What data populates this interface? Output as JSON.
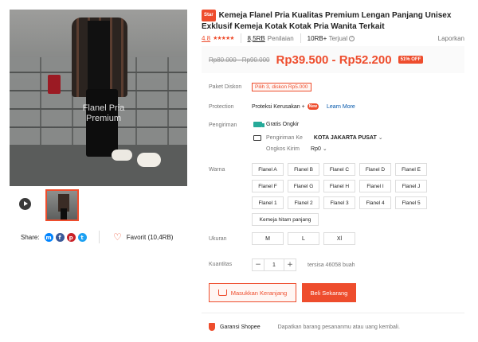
{
  "gallery": {
    "watermark_line1": "Flanel Pria",
    "watermark_line2": "Premium"
  },
  "share": {
    "label": "Share:",
    "networks": [
      "messenger-icon",
      "facebook-icon",
      "pinterest-icon",
      "twitter-icon"
    ]
  },
  "favorite": {
    "label": "Favorit (10,4RB)"
  },
  "product": {
    "badge": "Star",
    "title": "Kemeja Flanel Pria Kualitas Premium Lengan Panjang Unisex Exklusif Kemeja Kotak Kotak Pria Wanita Terkait",
    "rating": "4.8",
    "stars": "★★★★★",
    "ratings_count": "8,5RB",
    "ratings_label": "Penilaian",
    "sold_count": "10RB+",
    "sold_label": "Terjual",
    "report": "Laporkan"
  },
  "price": {
    "original": "Rp80.000 - Rp90.000",
    "current": "Rp39.500 - Rp52.200",
    "discount": "51% OFF"
  },
  "labels": {
    "paket": "Paket Diskon",
    "protection": "Protection",
    "shipping": "Pengiriman",
    "color": "Warna",
    "size": "Ukuran",
    "quantity": "Kuantitas"
  },
  "paket_chip": "Pilih 3, diskon Rp5.000",
  "protection": {
    "text": "Proteksi Kerusakan +",
    "new_badge": "New",
    "learn_more": "Learn More"
  },
  "shipping": {
    "free": "Gratis Ongkir",
    "to_label": "Pengiriman Ke",
    "to_value": "KOTA JAKARTA PUSAT",
    "cost_label": "Ongkos Kirim",
    "cost_value": "Rp0"
  },
  "variants": [
    "Flanel A",
    "Flanel B",
    "Flanel C",
    "Flanel D",
    "Flanel E",
    "Flanel F",
    "Flanel G",
    "Flanel H",
    "Flanel I",
    "Flanel J",
    "Flanel 1",
    "Flanel 2",
    "Flanel 3",
    "Flanel 4",
    "Flanel 5",
    "Kemeja hitam panjang"
  ],
  "sizes": [
    "M",
    "L",
    "Xl"
  ],
  "quantity": {
    "minus": "−",
    "value": "1",
    "plus": "+",
    "stock": "tersisa 46058 buah"
  },
  "actions": {
    "cart": "Masukkan Keranjang",
    "buy": "Beli Sekarang"
  },
  "guarantee": {
    "title": "Garansi Shopee",
    "desc": "Dapatkan barang pesananmu atau uang kembali."
  },
  "colors": {
    "accent": "#ee4d2d",
    "link": "#0055aa",
    "free_shipping": "#26aa99"
  }
}
